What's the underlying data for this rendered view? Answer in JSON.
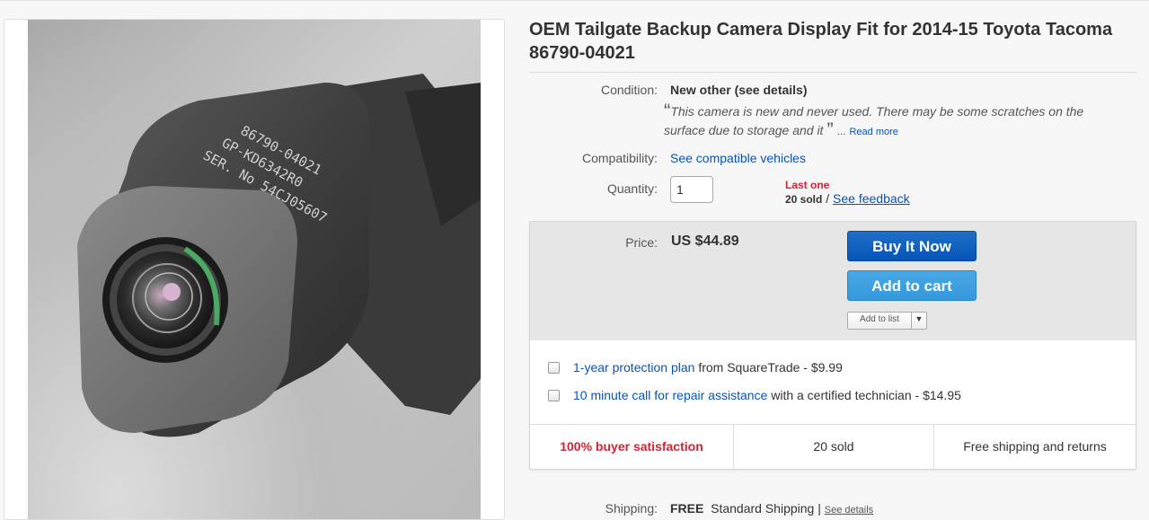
{
  "listing": {
    "title": "OEM Tailgate Backup Camera Display Fit for 2014-15 Toyota Tacoma 86790-04021"
  },
  "image": {
    "alt": "Backup camera product photo",
    "engraving_lines": [
      "86790-04021",
      "GP-KD6342R0",
      "SER. No 54CJ05607"
    ]
  },
  "condition": {
    "label": "Condition:",
    "value": "New other (see details)",
    "description": "This camera is new and never used. There may be some scratches on the surface due to storage and it",
    "ellipsis": "...",
    "read_more": "Read more"
  },
  "compatibility": {
    "label": "Compatibility:",
    "link": "See compatible vehicles"
  },
  "quantity": {
    "label": "Quantity:",
    "value": "1",
    "availability": "Last one",
    "sold_count": "20 sold",
    "separator": "/",
    "feedback_link": "See feedback"
  },
  "price": {
    "label": "Price:",
    "value": "US $44.89"
  },
  "buttons": {
    "buy_now": "Buy It Now",
    "add_to_cart": "Add to cart",
    "add_to_list": "Add to list"
  },
  "addons": [
    {
      "link": "1-year protection plan",
      "text": "from SquareTrade - $9.99"
    },
    {
      "link": "10 minute call for repair assistance",
      "text": "with a certified technician - $14.95"
    }
  ],
  "highlights": {
    "satisfaction": "100% buyer satisfaction",
    "sold": "20 sold",
    "shipping": "Free shipping and returns"
  },
  "shipping": {
    "label": "Shipping:",
    "cost": "FREE",
    "method": "Standard Shipping |",
    "details_link": "See details"
  },
  "colors": {
    "link": "#0654ba",
    "alert_red": "#dd1e31",
    "buy_button": "#0654ba",
    "cart_button": "#3498db"
  }
}
